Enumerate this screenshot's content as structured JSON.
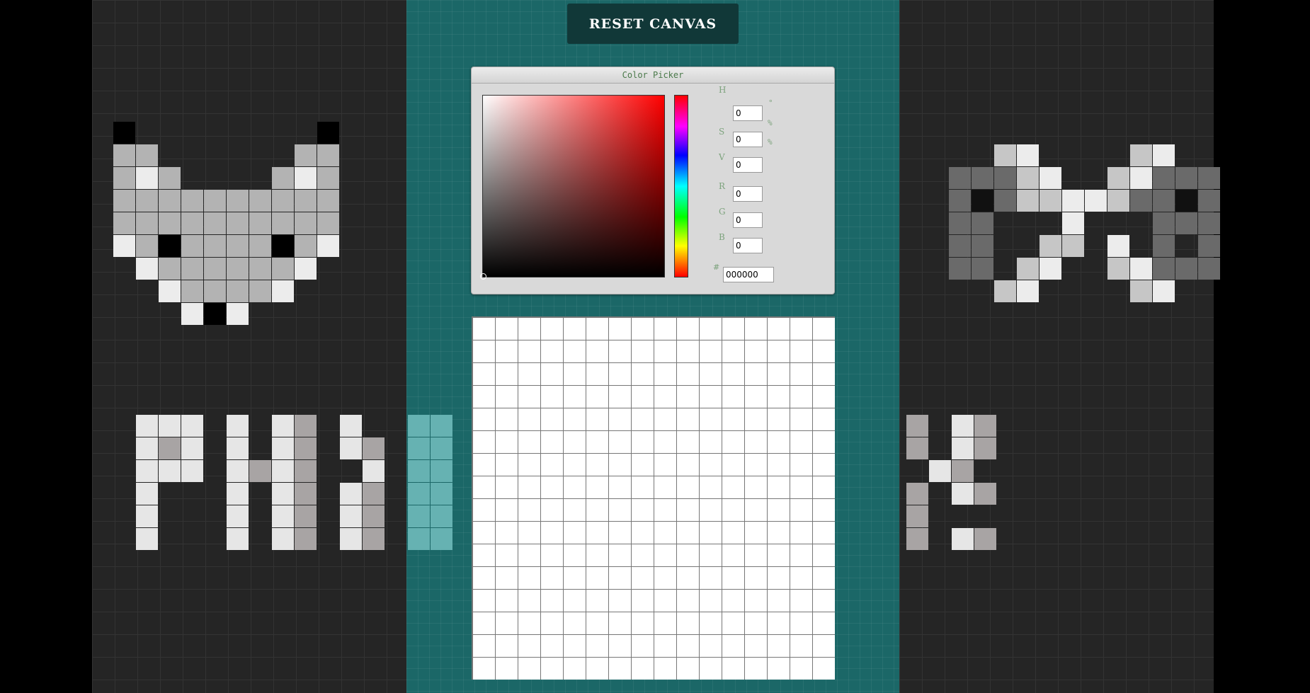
{
  "app": {
    "reset_label": "RESET CANVAS"
  },
  "color_picker": {
    "title": "Color Picker",
    "hsv": [
      {
        "label": "H",
        "value": "0",
        "unit": "°"
      },
      {
        "label": "S",
        "value": "0",
        "unit": "%"
      },
      {
        "label": "V",
        "value": "0",
        "unit": "%"
      }
    ],
    "rgb": [
      {
        "label": "R",
        "value": "0"
      },
      {
        "label": "G",
        "value": "0"
      },
      {
        "label": "B",
        "value": "0"
      }
    ],
    "hex_label": "#",
    "hex_value": "000000",
    "current_hue_color": "#ff0000"
  },
  "drawing_canvas": {
    "rows": 16,
    "cols": 16,
    "cell_color": "#ffffff",
    "grid_color": "#777777"
  },
  "colors": {
    "page_background": "#000000",
    "side_panel": "#252525",
    "center_panel": "#1b6767",
    "button_background": "#113838",
    "panel_label": "#7da37d"
  },
  "decoration": {
    "left_art": "grey pixel cat face",
    "right_art": "grey pixel cat face",
    "banner_text_art": "PIXEL ART"
  }
}
